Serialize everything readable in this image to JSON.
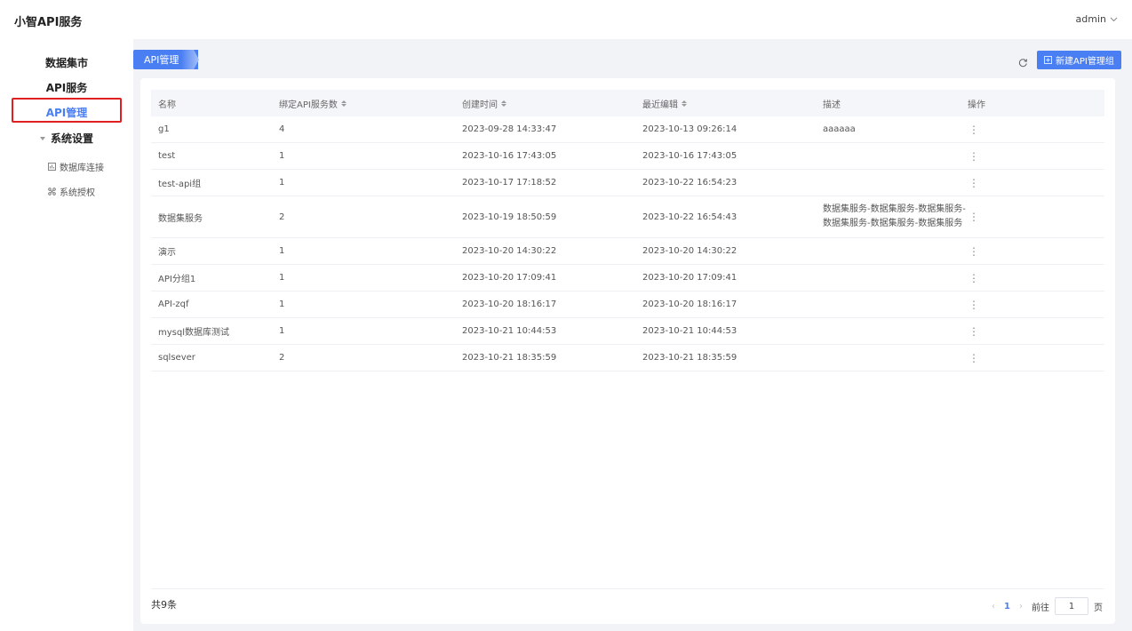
{
  "header": {
    "app_title": "小智API服务",
    "user": "admin"
  },
  "sidebar": {
    "items": [
      {
        "label": "数据集市"
      },
      {
        "label": "API服务"
      },
      {
        "label": "API管理"
      }
    ],
    "group": {
      "label": "系统设置"
    },
    "sub_items": [
      {
        "label": "数据库连接",
        "icon": "database-icon"
      },
      {
        "label": "系统授权",
        "icon": "authorize-icon"
      }
    ]
  },
  "main": {
    "tab_label": "API管理",
    "new_button_label": "新建API管理组",
    "table": {
      "columns": [
        "名称",
        "绑定API服务数",
        "创建时间",
        "最近编辑",
        "描述",
        "操作"
      ],
      "rows": [
        {
          "name": "g1",
          "count": "4",
          "created": "2023-09-28 14:33:47",
          "edited": "2023-10-13 09:26:14",
          "desc": "aaaaaa"
        },
        {
          "name": "test",
          "count": "1",
          "created": "2023-10-16 17:43:05",
          "edited": "2023-10-16 17:43:05",
          "desc": ""
        },
        {
          "name": "test-api组",
          "count": "1",
          "created": "2023-10-17 17:18:52",
          "edited": "2023-10-22 16:54:23",
          "desc": ""
        },
        {
          "name": "数据集服务",
          "count": "2",
          "created": "2023-10-19 18:50:59",
          "edited": "2023-10-22 16:54:43",
          "desc": "数据集服务-数据集服务-数据集服务-",
          "desc2": "数据集服务-数据集服务-数据集服务"
        },
        {
          "name": "演示",
          "count": "1",
          "created": "2023-10-20 14:30:22",
          "edited": "2023-10-20 14:30:22",
          "desc": ""
        },
        {
          "name": "API分组1",
          "count": "1",
          "created": "2023-10-20 17:09:41",
          "edited": "2023-10-20 17:09:41",
          "desc": ""
        },
        {
          "name": "API-zqf",
          "count": "1",
          "created": "2023-10-20 18:16:17",
          "edited": "2023-10-20 18:16:17",
          "desc": ""
        },
        {
          "name": "mysql数据库测试",
          "count": "1",
          "created": "2023-10-21 10:44:53",
          "edited": "2023-10-21 10:44:53",
          "desc": ""
        },
        {
          "name": "sqlsever",
          "count": "2",
          "created": "2023-10-21 18:35:59",
          "edited": "2023-10-21 18:35:59",
          "desc": ""
        }
      ],
      "action_glyph": "⋮"
    },
    "footer": {
      "total": "共9条",
      "current_page": "1",
      "goto_prefix": "前往",
      "goto_value": "1",
      "goto_suffix": "页"
    }
  },
  "colors": {
    "accent": "#4a7ff3",
    "highlight_box": "#e02020",
    "background": "#f2f3f7"
  }
}
